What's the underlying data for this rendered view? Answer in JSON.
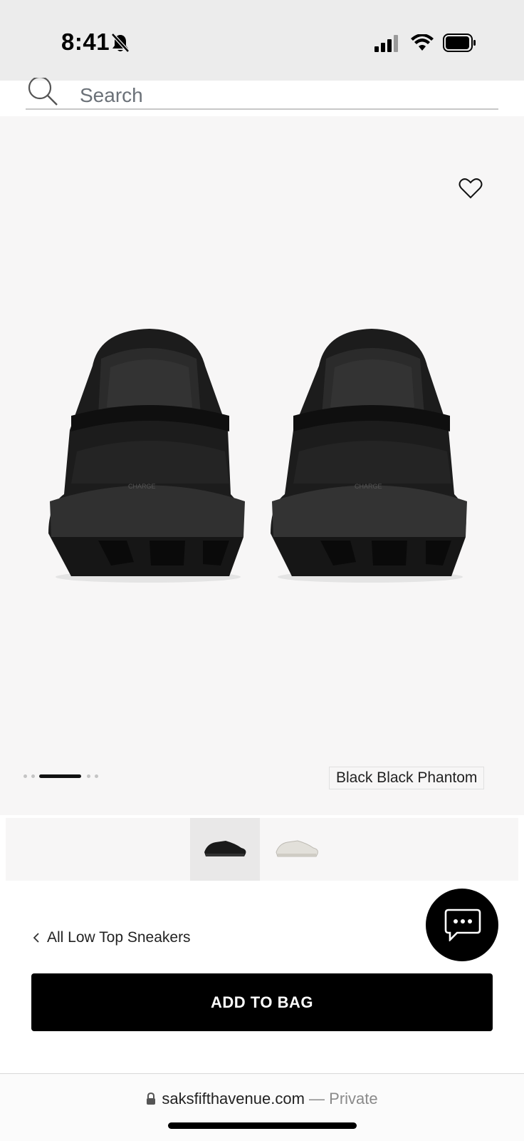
{
  "status_bar": {
    "time": "8:41",
    "icons": [
      "bell-slash-icon",
      "signal-icon",
      "wifi-icon",
      "battery-icon"
    ]
  },
  "search": {
    "placeholder": "Search",
    "icon": "search-icon"
  },
  "product": {
    "wishlist_icon": "heart-icon",
    "color_name": "Black Black Phantom",
    "image_count": 4,
    "active_image_index": 1,
    "swatches": [
      {
        "label": "black",
        "selected": true
      },
      {
        "label": "white",
        "selected": false
      }
    ]
  },
  "navigation": {
    "breadcrumb_label": "All Low Top Sneakers"
  },
  "actions": {
    "add_to_bag_label": "ADD TO BAG",
    "chat_icon": "chat-icon"
  },
  "browser": {
    "domain": "saksfifthavenue.com",
    "mode": "— Private"
  },
  "colors": {
    "accent": "#000000",
    "stage_bg": "#f7f6f6",
    "status_bg": "#ececec"
  }
}
